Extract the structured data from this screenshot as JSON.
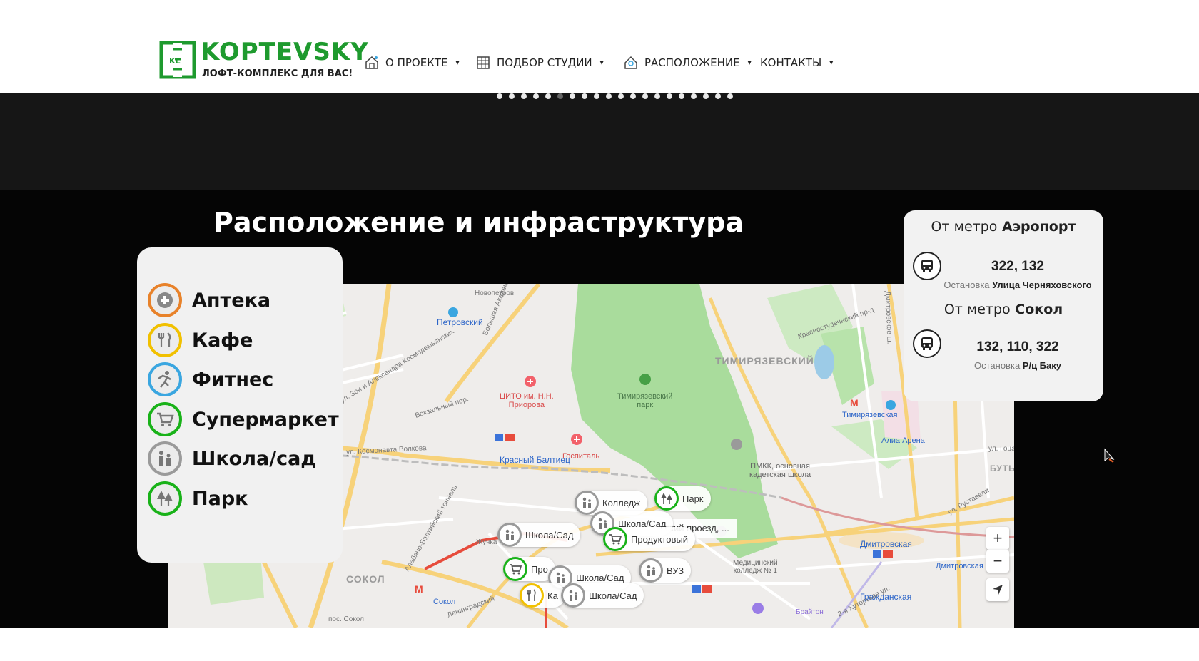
{
  "logo": {
    "name": "KOPTEVSKY",
    "tagline": "ЛОФТ-КОМПЛЕКС ДЛЯ ВАС!",
    "mark_text": "KL"
  },
  "nav": [
    {
      "label": "О ПРОЕКТЕ",
      "icon": "house-icon"
    },
    {
      "label": "ПОДБОР СТУДИИ",
      "icon": "building-icon"
    },
    {
      "label": "РАСПОЛОЖЕНИЕ",
      "icon": "location-house-icon"
    },
    {
      "label": "КОНТАКТЫ",
      "icon": ""
    }
  ],
  "slider": {
    "dot_count": 20,
    "active_index": 5
  },
  "section": {
    "title": "Расположение и инфраструктура"
  },
  "legend": [
    {
      "label": "Аптека",
      "icon": "pharmacy-cross-icon",
      "color": "#e8822a"
    },
    {
      "label": "Кафе",
      "icon": "cutlery-icon",
      "color": "#f1c000"
    },
    {
      "label": "Фитнес",
      "icon": "runner-icon",
      "color": "#3aa6e0"
    },
    {
      "label": "Супермаркет",
      "icon": "cart-icon",
      "color": "#19b219"
    },
    {
      "label": "Школа/сад",
      "icon": "family-icon",
      "color": "#9a9a9a"
    },
    {
      "label": "Парк",
      "icon": "trees-icon",
      "color": "#19b219"
    }
  ],
  "transport": {
    "blocks": [
      {
        "heading_prefix": "От метро",
        "heading_station": "Аэропорт",
        "routes": "322, 132",
        "stop_prefix": "Остановка",
        "stop_name": "Улица Черняховского"
      },
      {
        "heading_prefix": "От метро",
        "heading_station": "Сокол",
        "routes": "132, 110, 322",
        "stop_prefix": "Остановка",
        "stop_name": "Р/ц Баку"
      }
    ]
  },
  "map": {
    "labels": {
      "petrovsky": "Петровский",
      "novopetrovskaya": "Новопетров",
      "bolshaya_akadem": "Большая Академиче",
      "timiryazevsky": "ТИМИРЯЗЕВСКИЙ",
      "timiryazevsky_park": "Тимирязевский\nпарк",
      "cito": "ЦИТО им. Н.Н.\nПриорова",
      "krasny_baltiets": "Красный Балтиец",
      "gospital": "Госпиталь",
      "kosmonavta": "ул. Космонавта Волкова",
      "zoi": "ул. Зои и Александра Космодемьянских",
      "vokzalny": "Вокзальный пер.",
      "baltiysky": "Алабяно-Балтийский тоннель",
      "sokol_area": "СОКОЛ",
      "sokol_metro": "Сокол",
      "leningradsky": "Ленинградский",
      "pmkk": "ПМКК, основная\nкадетская школа",
      "timiryazevskaya": "Тимирязевская",
      "alia_arena": "Алиа Арена",
      "dmitrovskaya": "Дмитровская",
      "dmitrovskaya2": "Дмитровская",
      "grazhdanskaya": "Гражданская",
      "medical": "Медицинский\nколледж № 1",
      "brighton": "Брайтон",
      "krasnostud": "Красностудечнский пр-д",
      "dmitrovskoe": "Дмитровское ш.",
      "zhuchka": "Жучка",
      "pos_sokol": "пос. Сокол",
      "butyr": "БУТЬ",
      "gotsa": "ул. Гоца",
      "khutorskaya": "2-я Хуторская ул.",
      "rustaveli": "ул. Руставели"
    },
    "markers": [
      {
        "type": "school",
        "text": "Колледж",
        "ring": "gray"
      },
      {
        "type": "park",
        "text": "Парк",
        "ring": "green"
      },
      {
        "type": "school",
        "text": "Школа/Сад",
        "ring": "gray"
      },
      {
        "type": "school",
        "text": "Школа/Сад",
        "ring": "gray"
      },
      {
        "type": "market",
        "text": "Продуктовый",
        "ring": "green"
      },
      {
        "type": "school",
        "text": "ВУЗ",
        "ring": "gray"
      },
      {
        "type": "market",
        "text": "Про",
        "ring": "green"
      },
      {
        "type": "school",
        "text": "Школа/Сад",
        "ring": "gray"
      },
      {
        "type": "cafe",
        "text": "Ка",
        "ring": "yellow"
      },
      {
        "type": "school",
        "text": "Школа/Сад",
        "ring": "gray"
      }
    ],
    "street_popup": "вский проезд, ...",
    "zoom_in": "+",
    "zoom_out": "−"
  },
  "colors": {
    "brand_green": "#1e9a2e",
    "dark_band": "#161616",
    "section_bg": "#050505"
  }
}
